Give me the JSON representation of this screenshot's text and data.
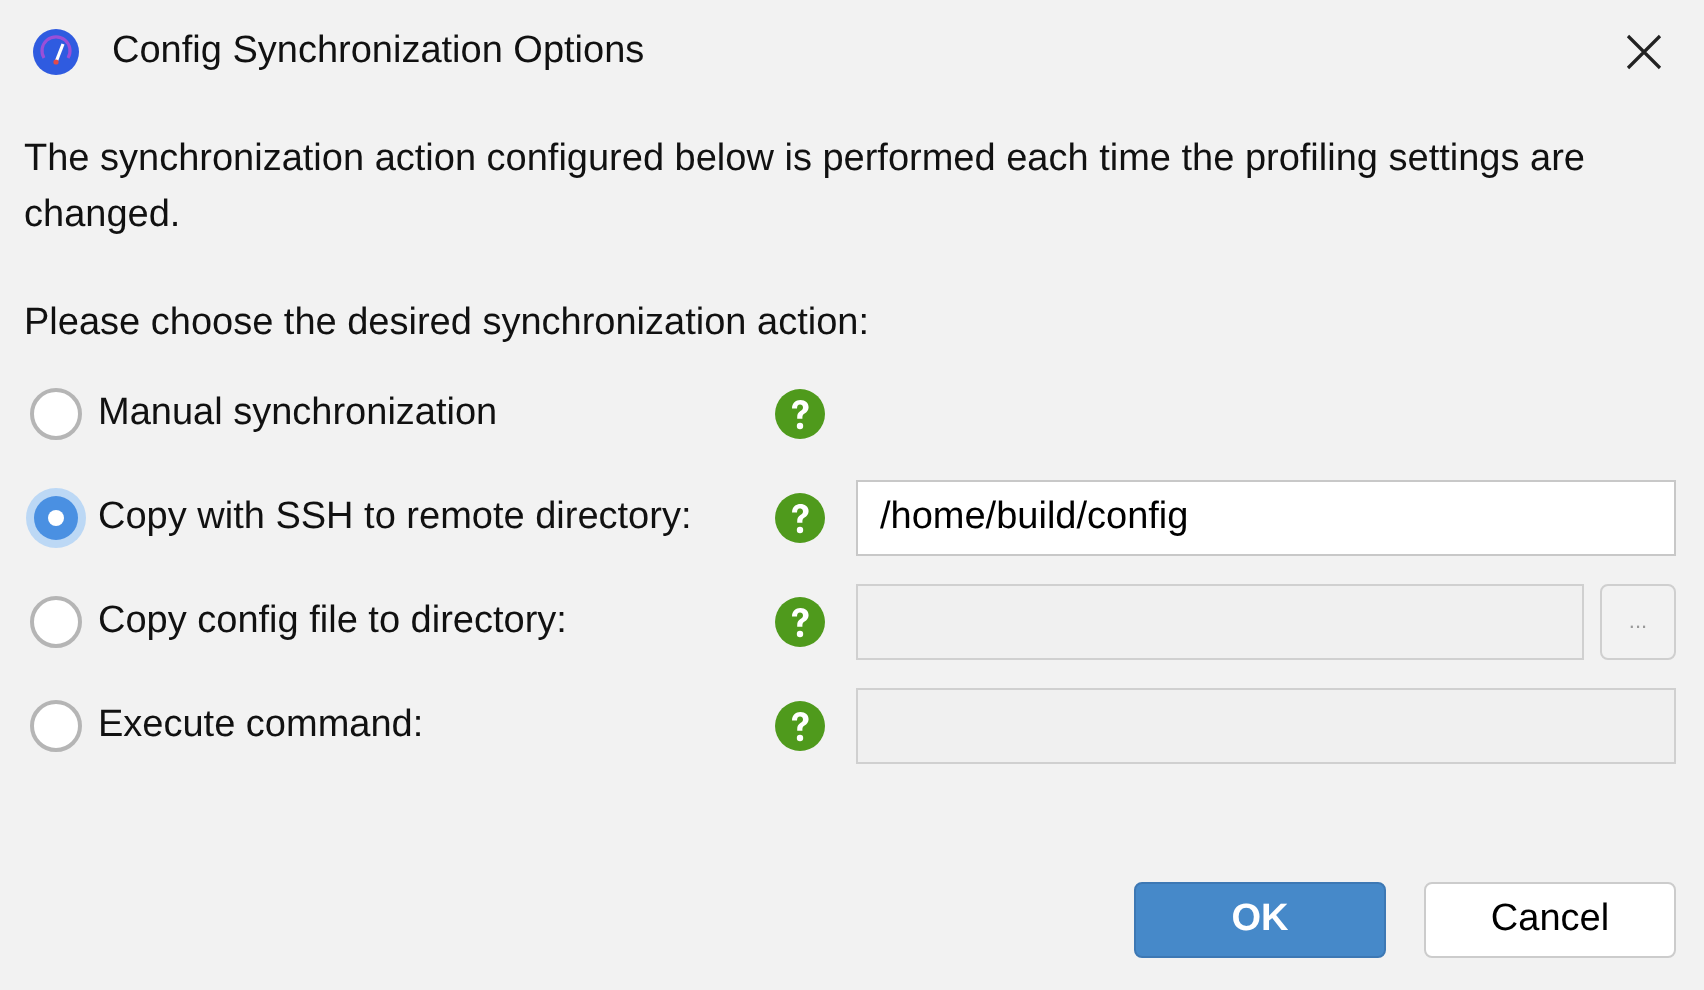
{
  "window": {
    "title": "Config Synchronization Options"
  },
  "description": "The synchronization action configured below is performed each time the profiling settings are changed.",
  "prompt": "Please choose the desired synchronization action:",
  "options": [
    {
      "label": "Manual synchronization",
      "selected": false,
      "kind": "plain"
    },
    {
      "label": "Copy with SSH to remote directory:",
      "selected": true,
      "kind": "field",
      "field": {
        "value": "/home/build/config",
        "disabled": false
      }
    },
    {
      "label": "Copy config file to directory:",
      "selected": false,
      "kind": "browse",
      "field": {
        "disabled": true
      },
      "browse_label": "..."
    },
    {
      "label": "Execute command:",
      "selected": false,
      "kind": "field",
      "field": {
        "disabled": true
      }
    }
  ],
  "buttons": [
    {
      "label": "OK",
      "kind": "primary"
    },
    {
      "label": "Cancel",
      "kind": "secondary"
    }
  ]
}
